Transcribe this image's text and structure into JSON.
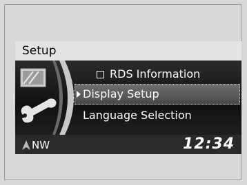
{
  "screen": {
    "title": "Setup",
    "menu": {
      "items": [
        {
          "label": "RDS Information",
          "has_checkbox": true,
          "selected": false
        },
        {
          "label": "Display Setup",
          "has_checkbox": false,
          "selected": true
        },
        {
          "label": "Language Selection",
          "has_checkbox": false,
          "selected": false
        }
      ]
    },
    "status": {
      "compass": "NW",
      "clock": "12:34"
    }
  }
}
